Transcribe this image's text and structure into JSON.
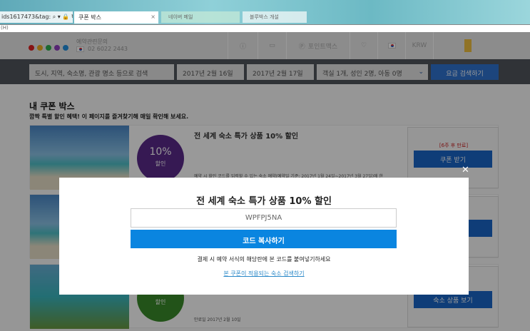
{
  "browser": {
    "address": "ids1617473&tag: ⌕ ▾ 🔒 ↻",
    "active_tab": "쿠폰 박스",
    "tab2": "네이버 메일",
    "tab3": "블루박스 개설",
    "menu": "(H)"
  },
  "header": {
    "contact_label": "예약관련문의",
    "phone": "02 6022 2443",
    "points": "포인트맥스",
    "currency": "KRW",
    "logo_colors": [
      "#e02020",
      "#f0b020",
      "#30b050",
      "#9040c0",
      "#2090e0"
    ]
  },
  "search": {
    "destination": "도시, 지역, 숙소명, 관광 명소 등으로 검색",
    "checkin": "2017년 2월 16일",
    "checkout": "2017년 2월 17일",
    "guests": "객실 1개, 성인 2명, 아동 0명",
    "button": "요금 검색하기"
  },
  "page": {
    "title": "내 쿠폰 박스",
    "subtitle": "깜짝 특별 할인 혜택! 이 페이지를 즐겨찾기해 매일 확인해 보세요."
  },
  "coupons": [
    {
      "title": "전 세계 숙소 특가 상품 10% 할인",
      "percent": "10%",
      "label": "할인",
      "desc": "예약 시 할인 코드를 입력할 수 있는 숙소 예약(예약일 기준: 2017년 1월 24일~2017년 3월 27일)에 한",
      "expire": "[6주 후 만료]",
      "button": "쿠폰 받기",
      "color": "#5a2a8a"
    },
    {
      "title": "",
      "percent": "",
      "label": "",
      "desc": "",
      "expire": "",
      "button": "",
      "color": "#2a6ab0"
    },
    {
      "title": "",
      "percent": "",
      "label": "할인",
      "desc": "만료일 2017년 2월 10일",
      "expire": "",
      "button": "숙소 상품 보기",
      "color": "#3a8a2a"
    }
  ],
  "modal": {
    "title": "전 세계 숙소 특가 상품 10% 할인",
    "code": "WPFPJ5NA",
    "copy_button": "코드 복사하기",
    "note": "결제 시 예약 서식의 해당란에 본 코드를 붙여넣기하세요",
    "link": "본 쿠폰이 적용되는 숙소 검색하기",
    "close": "✕"
  }
}
